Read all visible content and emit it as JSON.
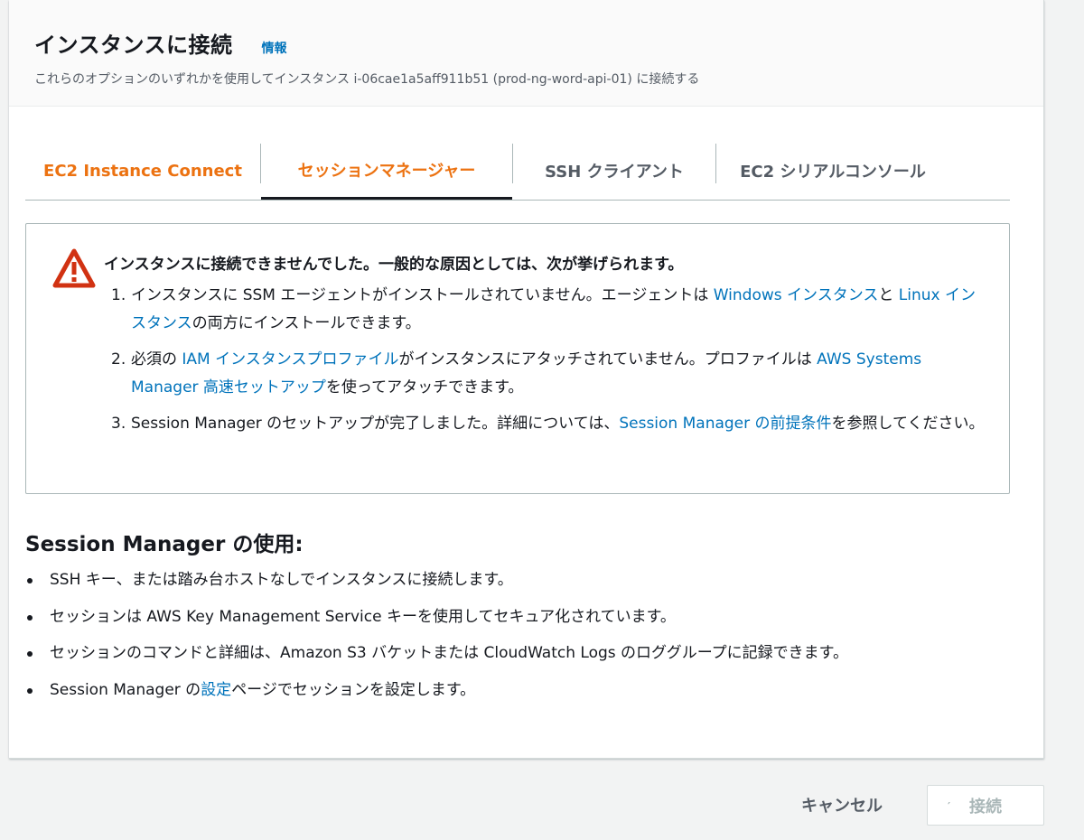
{
  "header": {
    "title": "インスタンスに接続",
    "info_link": "情報",
    "description": "これらのオプションのいずれかを使用してインスタンス i-06cae1a5aff911b51 (prod-ng-word-api-01) に接続する"
  },
  "tabs": [
    {
      "label": "EC2 Instance Connect",
      "active": false
    },
    {
      "label": "セッションマネージャー",
      "active": true
    },
    {
      "label": "SSH クライアント",
      "active": false
    },
    {
      "label": "EC2 シリアルコンソール",
      "active": false
    }
  ],
  "alert": {
    "icon": "warning-triangle-icon",
    "title": "インスタンスに接続できませんでした。一般的な原因としては、次が挙げられます。",
    "items": [
      {
        "num": "1.",
        "text_a": "インスタンスに SSM エージェントがインストールされていません。エージェントは ",
        "link_a": "Windows インスタンス",
        "text_b": "と ",
        "link_b": "Linux インスタンス",
        "text_c": "の両方にインストールできます。"
      },
      {
        "num": "2.",
        "text_a": "必須の ",
        "link_a": "IAM インスタンスプロファイル",
        "text_b": "がインスタンスにアタッチされていません。プロファイルは ",
        "link_b": "AWS Systems Manager 高速セットアップ",
        "text_c": "を使ってアタッチできます。"
      },
      {
        "num": "3.",
        "text_a": "Session Manager のセットアップが完了しました。詳細については、",
        "link_a": "Session Manager の前提条件",
        "text_b": "を参照してください。"
      }
    ]
  },
  "usage": {
    "title": "Session Manager の使用:",
    "items": [
      "SSH キー、または踏み台ホストなしでインスタンスに接続します。",
      "セッションは AWS Key Management Service キーを使用してセキュア化されています。",
      "セッションのコマンドと詳細は、Amazon S3 バケットまたは CloudWatch Logs のロググループに記録できます。"
    ],
    "item4_a": "Session Manager の",
    "item4_link": "設定",
    "item4_b": "ページでセッションを設定します。"
  },
  "footer": {
    "cancel_label": "キャンセル",
    "connect_label": "接続"
  },
  "colors": {
    "accent_orange": "#ec7211",
    "link_blue": "#0073bb",
    "warning_red": "#d13212"
  }
}
